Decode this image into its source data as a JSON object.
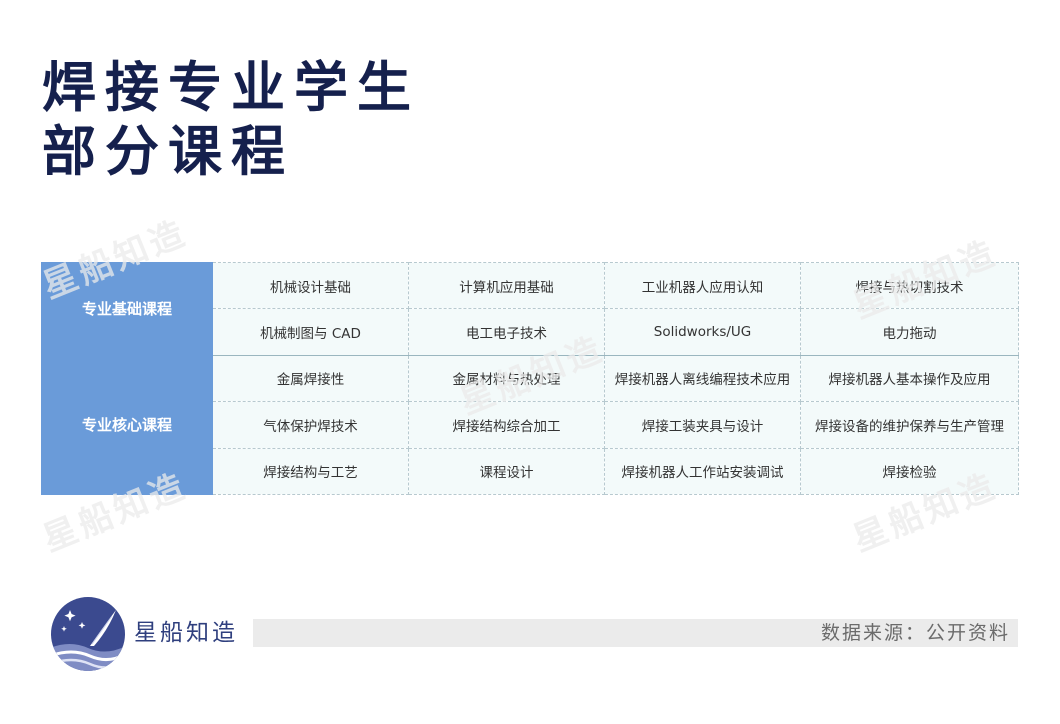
{
  "title": {
    "line1": "焊接专业学生",
    "line2": "部分课程"
  },
  "watermark": "星船知造",
  "courses": {
    "foundation": {
      "label": "专业基础课程",
      "rows": [
        [
          "机械设计基础",
          "计算机应用基础",
          "工业机器人应用认知",
          "焊接与热切割技术"
        ],
        [
          "机械制图与 CAD",
          "电工电子技术",
          "Solidworks/UG",
          "电力拖动"
        ]
      ]
    },
    "core": {
      "label": "专业核心课程",
      "rows": [
        [
          "金属焊接性",
          "金属材料与热处理",
          "焊接机器人离线编程技术应用",
          "焊接机器人基本操作及应用"
        ],
        [
          "气体保护焊技术",
          "焊接结构综合加工",
          "焊接工装夹具与设计",
          "焊接设备的维护保养与生产管理"
        ],
        [
          "焊接结构与工艺",
          "课程设计",
          "焊接机器人工作站安装调试",
          "焊接检验"
        ]
      ]
    }
  },
  "footer": {
    "brand": "星船知造",
    "source": "数据来源：公开资料"
  },
  "colors": {
    "title": "#15204d",
    "category_bg": "#6a9bd9",
    "cell_bg": "#f3fafa",
    "logo_bg": "#3b4a8f"
  }
}
